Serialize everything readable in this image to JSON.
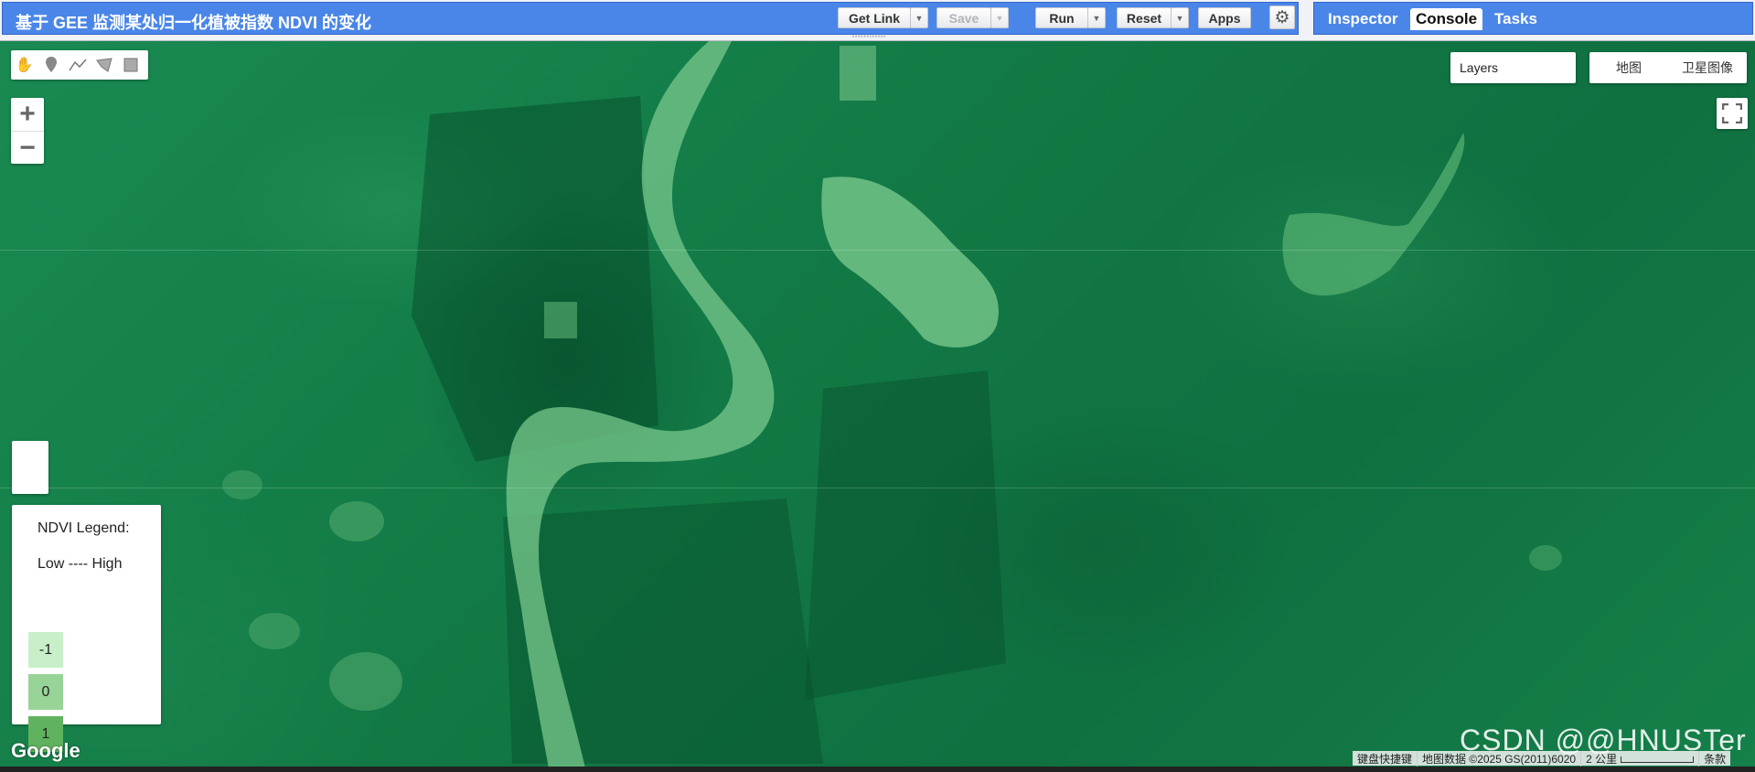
{
  "title": "基于 GEE 监测某处归一化植被指数 NDVI 的变化",
  "toolbar": {
    "get_link": "Get Link",
    "save": "Save",
    "run": "Run",
    "reset": "Reset",
    "apps": "Apps"
  },
  "right_tabs": [
    "Inspector",
    "Console",
    "Tasks"
  ],
  "map": {
    "layers_label": "Layers",
    "map_types": [
      "地图",
      "卫星图像"
    ],
    "legend": {
      "title": "NDVI Legend:",
      "range": "Low ---- High",
      "items": [
        {
          "label": "-1",
          "color": "#c9efc9"
        },
        {
          "label": "0",
          "color": "#98d498"
        },
        {
          "label": "1",
          "color": "#5fb35f"
        }
      ]
    },
    "attribution": {
      "shortcuts": "键盘快捷键",
      "data": "地图数据 ©2025 GS(2011)6020",
      "scale": "2 公里",
      "terms": "条款"
    },
    "google_logo": "Google",
    "watermark": "CSDN @@HNUSTer"
  }
}
